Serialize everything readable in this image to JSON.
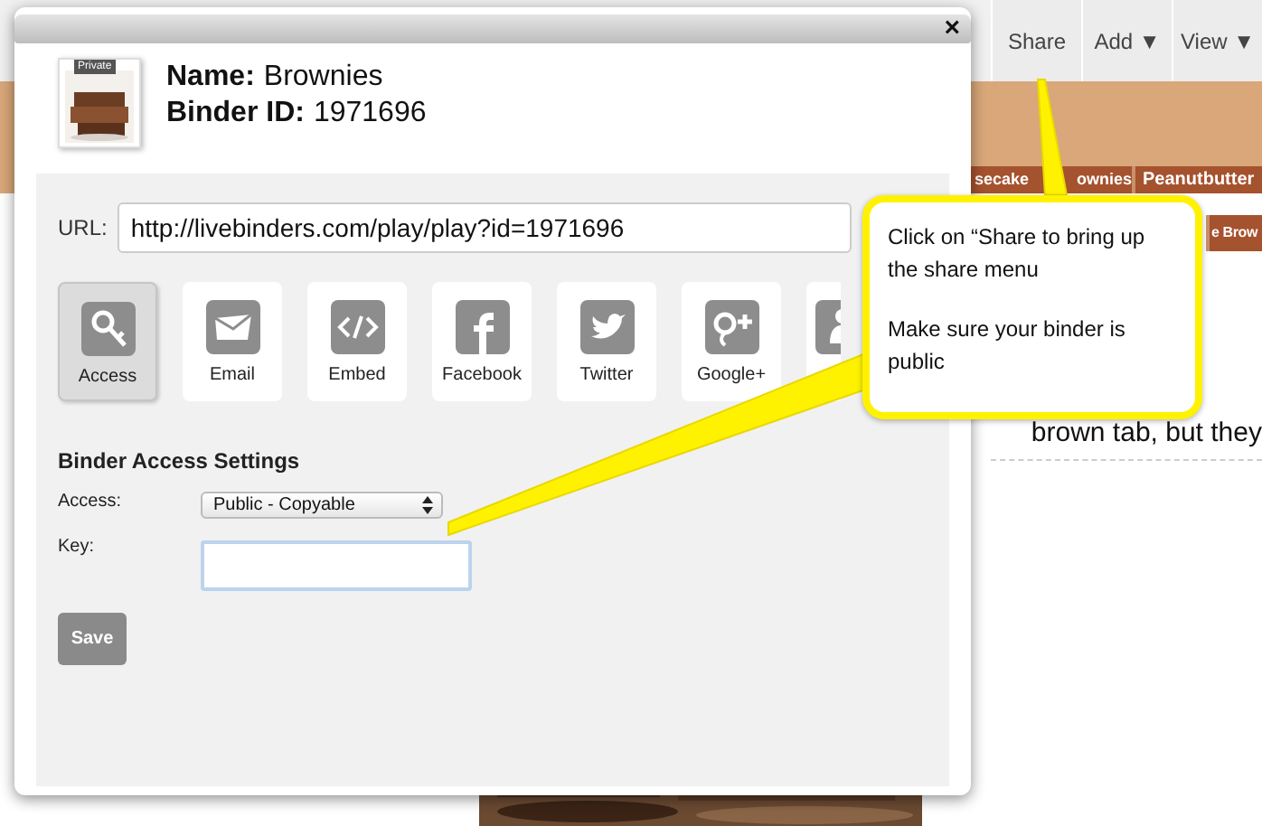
{
  "toolbar": {
    "buttons": [
      {
        "label": "Share"
      },
      {
        "label": "Add ▼"
      },
      {
        "label": "View ▼"
      }
    ]
  },
  "tabs_row_1": [
    {
      "texts": [
        "secake",
        "ownies"
      ]
    },
    {
      "texts": [
        "Peanutbutter"
      ]
    }
  ],
  "tabs_row_2": [
    "e Brow"
  ],
  "page_text": "brown tab, but they",
  "dialog": {
    "close": "×",
    "thumbnail_badge": "Private",
    "name_label": "Name:",
    "name": "Brownies",
    "id_label": "Binder ID:",
    "binder_id": "1971696",
    "url_label": "URL:",
    "url": "http://livebinders.com/play/play?id=1971696",
    "share_options": [
      {
        "label": "Access",
        "kind": "access",
        "selected": true
      },
      {
        "label": "Email",
        "kind": "email",
        "selected": false
      },
      {
        "label": "Embed",
        "kind": "embed",
        "selected": false
      },
      {
        "label": "Facebook",
        "kind": "facebook",
        "selected": false
      },
      {
        "label": "Twitter",
        "kind": "twitter",
        "selected": false
      },
      {
        "label": "Google+",
        "kind": "googleplus",
        "selected": false
      },
      {
        "kind": "group",
        "selected": false
      }
    ],
    "settings": {
      "heading": "Binder Access Settings",
      "access_label": "Access:",
      "access_value": "Public - Copyable",
      "key_label": "Key:",
      "save": "Save"
    }
  },
  "callout": {
    "paragraphs": [
      "Click on “Share to bring up the share menu",
      "Make sure your binder is public"
    ]
  }
}
